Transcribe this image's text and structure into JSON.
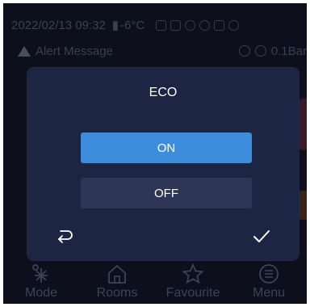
{
  "status_bar": {
    "datetime": "2022/02/13 09:32",
    "temperature": "-6°C"
  },
  "alert_bar": {
    "label": "Alert Message",
    "pressure": "0.1Bar"
  },
  "dialog": {
    "title": "ECO",
    "options": [
      {
        "label": "ON",
        "selected": true
      },
      {
        "label": "OFF",
        "selected": false
      }
    ],
    "back_icon": "return-arrow-icon",
    "confirm_icon": "checkmark-icon"
  },
  "bottom_nav": [
    {
      "label": "Mode",
      "icon": "snowflake-sun-icon"
    },
    {
      "label": "Rooms",
      "icon": "house-icon"
    },
    {
      "label": "Favourite",
      "icon": "star-icon"
    },
    {
      "label": "Menu",
      "icon": "menu-icon"
    }
  ],
  "colors": {
    "background": "#0d0f1c",
    "dialog": "#1c2541",
    "selected_option": "#3c8ddb",
    "unselected_option": "#2d3655",
    "text": "#ffffff"
  }
}
